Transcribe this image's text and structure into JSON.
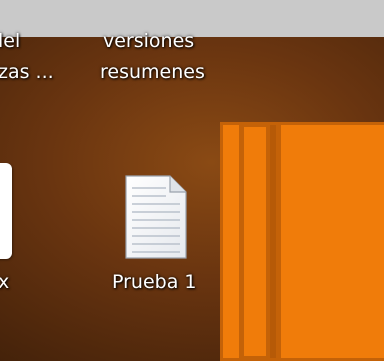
{
  "desktop": {
    "top_left_label_line1": "lel",
    "top_left_label_line2": "zas ...",
    "top_center_label_line1": "versiones",
    "top_center_label_line2": "resumenes",
    "left_partial_label": "x",
    "file_label": "Prueba 1"
  },
  "icons": {
    "file": "text-document-icon",
    "left_partial": "partial-file-icon"
  },
  "colors": {
    "title_bar": "#c9c9c9",
    "orange_window": "#f07c0a",
    "orange_border": "#c46208"
  }
}
